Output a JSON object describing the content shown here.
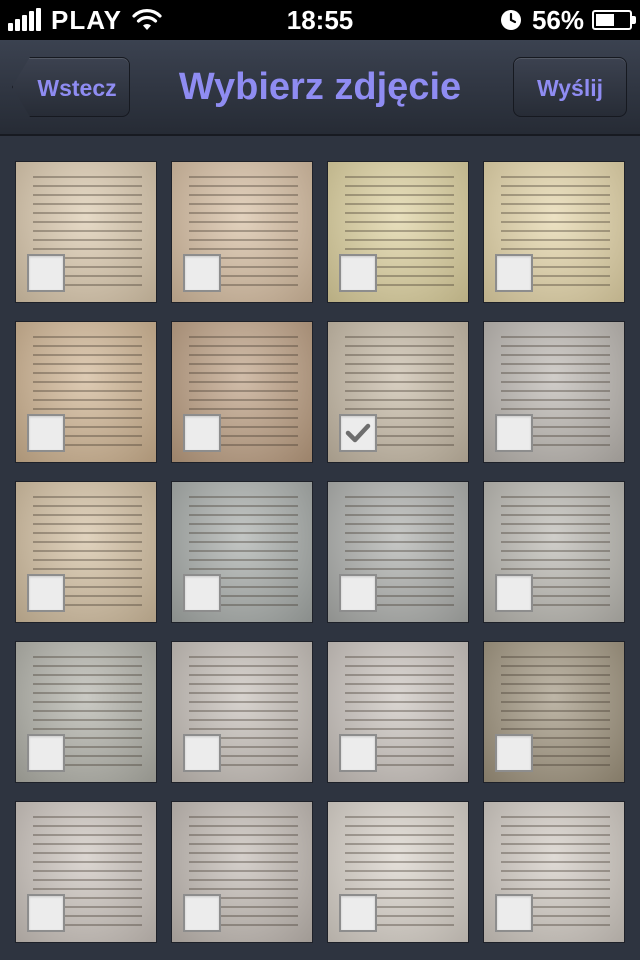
{
  "status_bar": {
    "carrier": "PLAY",
    "time": "18:55",
    "battery_percent": "56%",
    "battery_level": 0.56,
    "signal_icon": "signal-bars-icon",
    "wifi_icon": "wifi-icon",
    "clock_icon": "clock-icon"
  },
  "nav": {
    "back_label": "Wstecz",
    "title": "Wybierz zdjęcie",
    "send_label": "Wyślij"
  },
  "grid": {
    "photos": [
      {
        "tone": "#d9c6a9",
        "checked": false
      },
      {
        "tone": "#d4ba9c",
        "checked": false
      },
      {
        "tone": "#dccf9a",
        "checked": false
      },
      {
        "tone": "#e3d3a4",
        "checked": false
      },
      {
        "tone": "#cdb08c",
        "checked": false
      },
      {
        "tone": "#b99a7c",
        "checked": false
      },
      {
        "tone": "#c4b7a2",
        "checked": true
      },
      {
        "tone": "#b8b3ad",
        "checked": false
      },
      {
        "tone": "#d1bc9c",
        "checked": false
      },
      {
        "tone": "#a3a8a5",
        "checked": false
      },
      {
        "tone": "#a9aba8",
        "checked": false
      },
      {
        "tone": "#b7b5ae",
        "checked": false
      },
      {
        "tone": "#aeaea5",
        "checked": false
      },
      {
        "tone": "#c3bcb5",
        "checked": false
      },
      {
        "tone": "#c8c1bb",
        "checked": false
      },
      {
        "tone": "#9b8f78",
        "checked": false
      },
      {
        "tone": "#c9c1ba",
        "checked": false
      },
      {
        "tone": "#bfb7b0",
        "checked": false
      },
      {
        "tone": "#d7d0c7",
        "checked": false
      },
      {
        "tone": "#cfc8c0",
        "checked": false
      }
    ]
  },
  "colors": {
    "accent": "#8f8cf2",
    "background": "#2e3440",
    "status_bar": "#000000"
  }
}
